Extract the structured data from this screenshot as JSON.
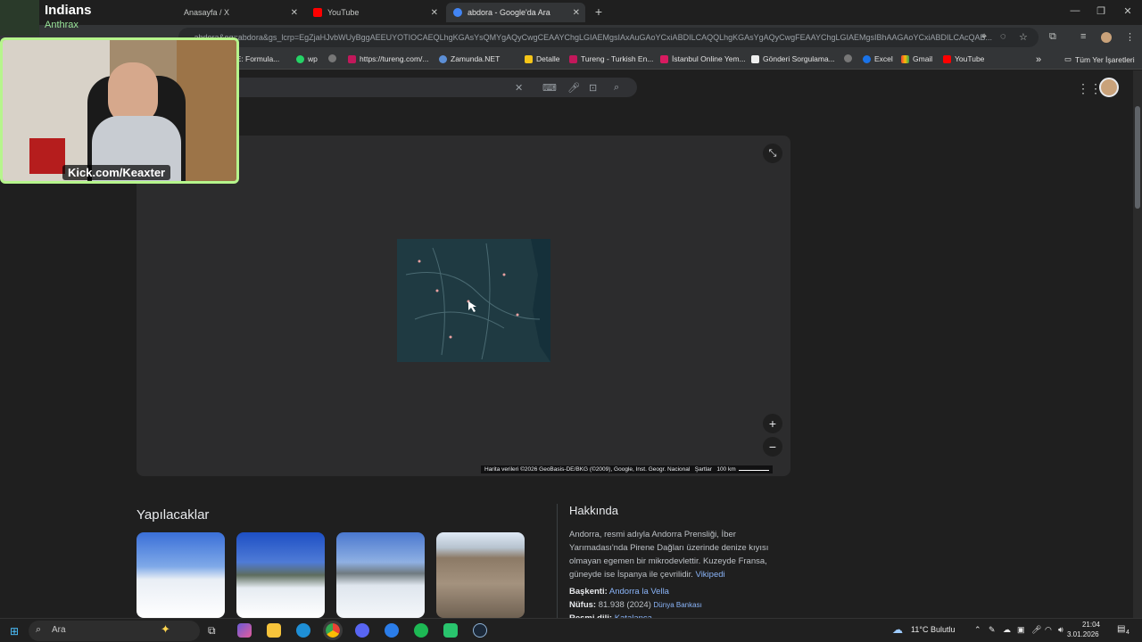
{
  "browser": {
    "tabs": [
      {
        "label": "Anasayfa / X",
        "favicon": "x-icon"
      },
      {
        "label": "YouTube",
        "favicon": "youtube-icon"
      },
      {
        "label": "abdora - Google'da Ara",
        "favicon": "google-icon",
        "active": true
      }
    ],
    "new_tab": "+",
    "url": "...abdora&oq=abdora&gs_lcrp=EgZjaHJvbWUyBggAEEUYOTIOCAEQLhgKGAsYsQMYgAQyCwgCEAAYChgLGIAEMgsIAxAuGAoYCxiABDILCAQQLhgKGAsYgAQyCwgFEAAYChgLGIAEMgsIBhAAGAoYCxiABDILCAcQAB...",
    "bookmarks": [
      {
        "label": "GE: Formula..."
      },
      {
        "label": "wp"
      },
      {
        "label": ""
      },
      {
        "label": "https://tureng.com/..."
      },
      {
        "label": "Zamunda.NET"
      },
      {
        "label": "Detalle"
      },
      {
        "label": "Tureng - Turkish En..."
      },
      {
        "label": "İstanbul Online Yem..."
      },
      {
        "label": "Gönderi Sorgulama..."
      },
      {
        "label": ""
      },
      {
        "label": "Excel"
      },
      {
        "label": "Gmail"
      },
      {
        "label": "YouTube"
      }
    ],
    "all_bookmarks": "Tüm Yer İşaretleri"
  },
  "page": {
    "map": {
      "attribution": "Harita verileri ©2026 GeoBasis-DE/BKG (©2009), Google, Inst. Geogr. Nacional",
      "terms": "Şartlar",
      "scale": "100 km",
      "zoom_in": "+",
      "zoom_out": "−"
    },
    "things_to_do": {
      "title": "Yapılacaklar"
    },
    "about": {
      "title": "Hakkında",
      "text": "Andorra, resmi adıyla Andorra Prensliği, İber Yarımadası'nda Pirene Dağları üzerinde denize kıyısı olmayan egemen bir mikrodevlettir. Kuzeyde Fransa, güneyde ise İspanya ile çevrilidir.",
      "source": "Vikipedi",
      "capital_label": "Başkenti:",
      "capital_value": "Andorra la Vella",
      "population_label": "Nüfus:",
      "population_value": "81.938 (2024)",
      "population_source": "Dünya Bankası",
      "language_label": "Resmi dili:",
      "language_value": "Katalanca"
    }
  },
  "stream": {
    "now_playing_title": "Indians",
    "now_playing_artist": "Anthrax",
    "cam_label": "Kick.com/Keaxter"
  },
  "taskbar": {
    "search_placeholder": "Ara",
    "weather": "11°C  Bulutlu",
    "time": "21:04",
    "date": "3.01.2026",
    "notifications": "4"
  },
  "colors": {
    "accent_link": "#8ab4f8",
    "cam_border": "#b6f58c",
    "map_water": "#1f3a42"
  }
}
